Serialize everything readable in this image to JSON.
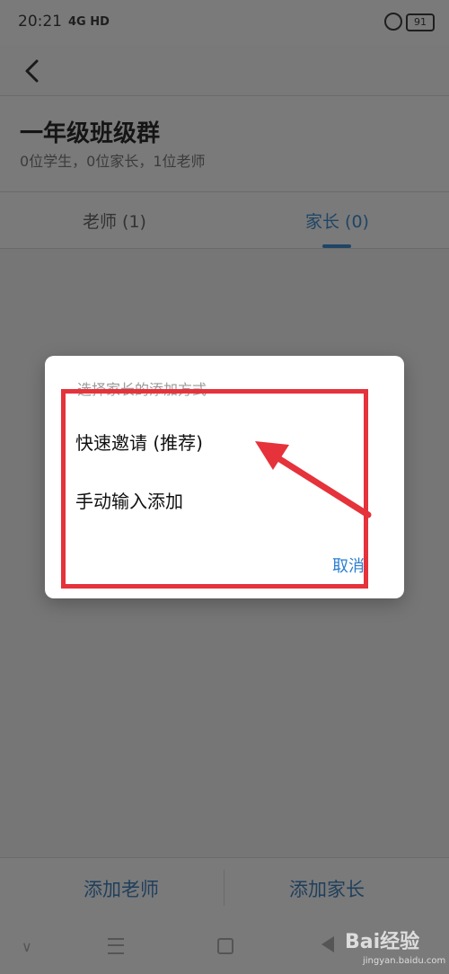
{
  "status": {
    "time": "20:21",
    "network": "4G HD",
    "battery": "91"
  },
  "group": {
    "title": "一年级班级群",
    "subtitle": "0位学生，0位家长，1位老师"
  },
  "tabs": [
    {
      "label": "老师 (1)",
      "active": false
    },
    {
      "label": "家长 (0)",
      "active": true
    }
  ],
  "bottom": {
    "add_teacher": "添加老师",
    "add_parent": "添加家长"
  },
  "dialog": {
    "title": "选择家长的添加方式",
    "options": [
      "快速邀请 (推荐)",
      "手动输入添加"
    ],
    "cancel": "取消"
  },
  "watermark": {
    "brand": "Bai经验",
    "url": "jingyan.baidu.com"
  },
  "colors": {
    "accent": "#2a7fd0",
    "annotation_red": "#e5323b",
    "dim_bg": "#777777"
  },
  "icons": [
    "back-icon",
    "alarm-icon",
    "battery-icon",
    "nav-down-icon",
    "nav-menu-icon",
    "nav-home-icon",
    "nav-back-icon"
  ]
}
